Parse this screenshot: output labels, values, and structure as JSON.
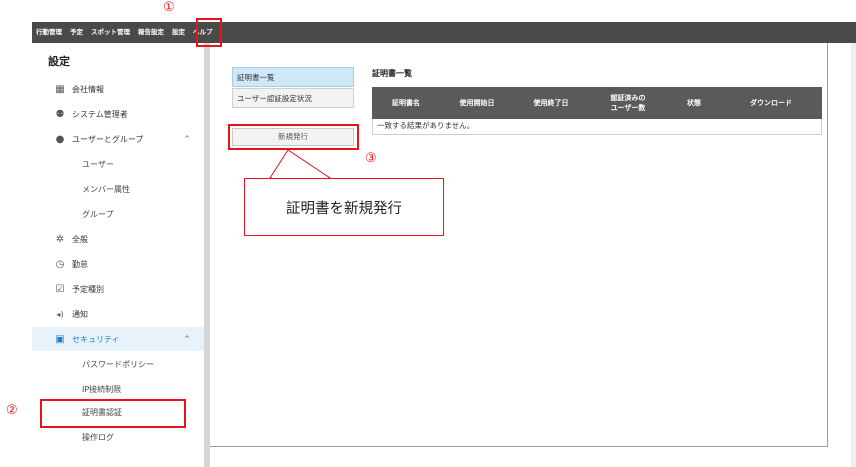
{
  "menu": {
    "items": [
      "行動管理",
      "予定",
      "スポット管理",
      "報告設定",
      "設定",
      "ヘルプ"
    ]
  },
  "sidebar": {
    "title": "設定",
    "items": [
      {
        "icon": "building-icon",
        "label": "会社情報"
      },
      {
        "icon": "admin-user-icon",
        "label": "システム管理者"
      },
      {
        "icon": "user-icon",
        "label": "ユーザーとグループ",
        "expanded": true
      },
      {
        "label": "ユーザー"
      },
      {
        "label": "メンバー属性"
      },
      {
        "label": "グループ"
      },
      {
        "icon": "gear-icon",
        "label": "全般"
      },
      {
        "icon": "clock-icon",
        "label": "勤怠"
      },
      {
        "icon": "calendar-check-icon",
        "label": "予定種別"
      },
      {
        "icon": "speaker-icon",
        "label": "通知"
      },
      {
        "icon": "lock-icon",
        "label": "セキュリティ",
        "expanded": true
      },
      {
        "label": "パスワードポリシー"
      },
      {
        "label": "IP接続制限"
      },
      {
        "label": "証明書認証"
      },
      {
        "label": "操作ログ"
      }
    ]
  },
  "subnav": {
    "items": [
      "証明書一覧",
      "ユーザー認証設定状況"
    ],
    "new_button": "新規発行"
  },
  "main": {
    "title": "証明書一覧",
    "columns": [
      "証明書名",
      "使用開始日",
      "使用終了日",
      "認証済みの\nユーザー数",
      "状態",
      "ダウンロード"
    ],
    "empty_message": "一致する結果がありません。"
  },
  "annotations": {
    "marker1": "①",
    "marker2": "②",
    "marker3": "③",
    "callout": "証明書を新規発行"
  },
  "colors": {
    "highlight": "#e8141b",
    "menubar": "#4a4a4a",
    "accent": "#1a7fd1"
  }
}
